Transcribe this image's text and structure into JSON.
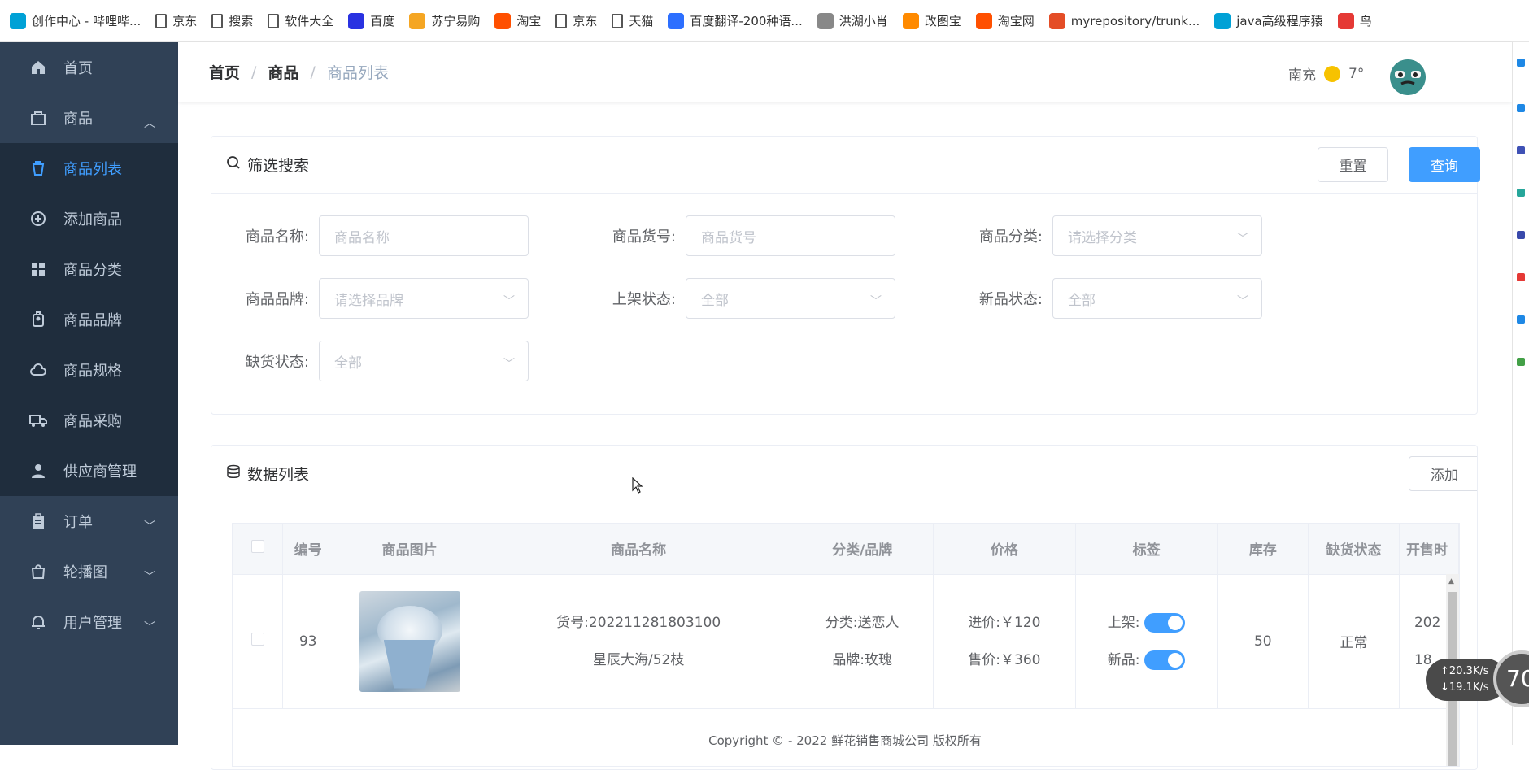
{
  "bookmarks": [
    {
      "label": "创作中心 - 哔哩哔...",
      "color": "#00a1d6"
    },
    {
      "label": "京东",
      "color": ""
    },
    {
      "label": "搜索",
      "color": ""
    },
    {
      "label": "软件大全",
      "color": ""
    },
    {
      "label": "百度",
      "color": "#2932e1"
    },
    {
      "label": "苏宁易购",
      "color": "#f5a623"
    },
    {
      "label": "淘宝",
      "color": "#ff5000"
    },
    {
      "label": "京东",
      "color": ""
    },
    {
      "label": "天猫",
      "color": ""
    },
    {
      "label": "百度翻译-200种语...",
      "color": "#2d6fff"
    },
    {
      "label": "洪湖小肖",
      "color": "#888888"
    },
    {
      "label": "改图宝",
      "color": "#ff8a00"
    },
    {
      "label": "淘宝网",
      "color": "#ff5000"
    },
    {
      "label": "myrepository/trunk...",
      "color": "#e44d26"
    },
    {
      "label": "java高级程序猿",
      "color": "#00a1d6"
    },
    {
      "label": "鸟",
      "color": "#e53935"
    }
  ],
  "sidebar": {
    "home": "首页",
    "goods": "商品",
    "sub": [
      "商品列表",
      "添加商品",
      "商品分类",
      "商品品牌",
      "商品规格",
      "商品采购",
      "供应商管理"
    ],
    "order": "订单",
    "carousel": "轮播图",
    "user": "用户管理"
  },
  "breadcrumb": {
    "home": "首页",
    "level2": "商品",
    "current": "商品列表",
    "sep": "/"
  },
  "weather": {
    "city": "南充",
    "temp": "7°"
  },
  "filter": {
    "title": "筛选搜索",
    "reset": "重置",
    "query": "查询",
    "fields": [
      {
        "label": "商品名称:",
        "placeholder": "商品名称"
      },
      {
        "label": "商品货号:",
        "placeholder": "商品货号"
      },
      {
        "label": "商品分类:",
        "placeholder": "请选择分类"
      },
      {
        "label": "商品品牌:",
        "placeholder": "请选择品牌"
      },
      {
        "label": "上架状态:",
        "placeholder": "全部"
      },
      {
        "label": "新品状态:",
        "placeholder": "全部"
      },
      {
        "label": "缺货状态:",
        "placeholder": "全部"
      }
    ]
  },
  "list": {
    "title": "数据列表",
    "add": "添加",
    "columns": [
      "编号",
      "商品图片",
      "商品名称",
      "分类/品牌",
      "价格",
      "标签",
      "库存",
      "缺货状态",
      "开售时"
    ],
    "row": {
      "id": "93",
      "sn": "货号:202211281803100",
      "name": "星辰大海/52枝",
      "category": "分类:送恋人",
      "brand": "品牌:玫瑰",
      "cost": "进价:￥120",
      "price": "售价:￥360",
      "tag_on": "上架:",
      "tag_new": "新品:",
      "on_sale": true,
      "is_new": true,
      "stock": "50",
      "shortage": "正常",
      "date1": "202",
      "date2": "18"
    }
  },
  "footer": "Copyright © - 2022 鲜花销售商城公司 版权所有",
  "net": {
    "up": "↑20.3K/s",
    "down": "↓19.1K/s",
    "gauge": "70"
  },
  "accent": "#409eff"
}
